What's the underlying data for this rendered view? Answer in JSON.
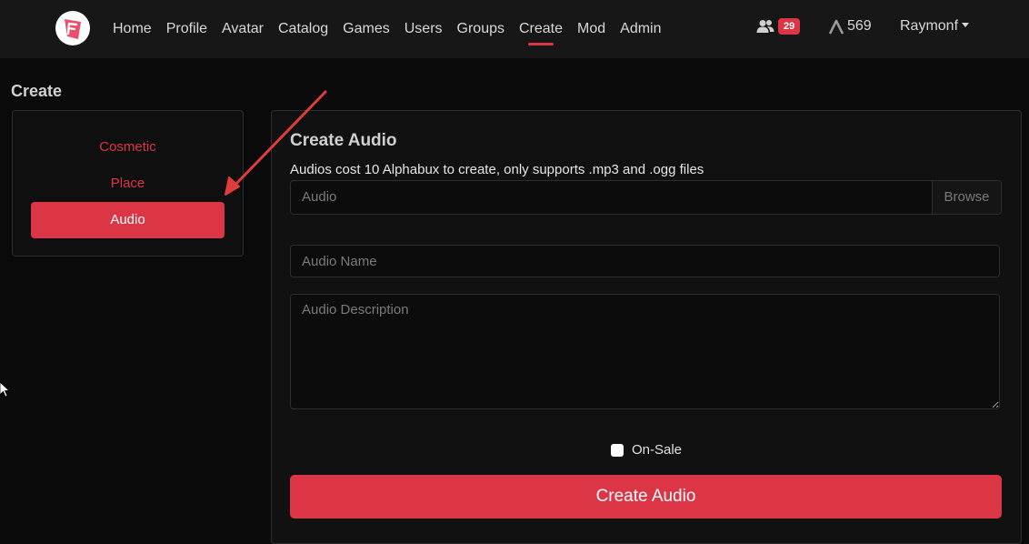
{
  "nav": {
    "items": [
      {
        "label": "Home"
      },
      {
        "label": "Profile"
      },
      {
        "label": "Avatar"
      },
      {
        "label": "Catalog"
      },
      {
        "label": "Games"
      },
      {
        "label": "Users"
      },
      {
        "label": "Groups"
      },
      {
        "label": "Create",
        "active": true
      },
      {
        "label": "Mod"
      },
      {
        "label": "Admin"
      }
    ],
    "friends_count": "29",
    "currency_amount": "569",
    "username": "Raymonf",
    "accent_color": "#dc3545"
  },
  "page": {
    "title": "Create"
  },
  "sidebar": {
    "items": [
      {
        "label": "Cosmetic"
      },
      {
        "label": "Place"
      },
      {
        "label": "Audio",
        "active": true
      }
    ]
  },
  "form": {
    "title": "Create Audio",
    "description": "Audios cost 10 Alphabux to create, only supports .mp3 and .ogg files",
    "file_placeholder": "Audio",
    "browse_label": "Browse",
    "name_placeholder": "Audio Name",
    "description_placeholder": "Audio Description",
    "on_sale_label": "On-Sale",
    "on_sale_checked": false,
    "submit_label": "Create Audio"
  },
  "icons": {
    "logo": "brand-logo-icon",
    "friends": "friends-icon",
    "currency": "alphabux-icon",
    "dropdown": "caret-down-icon"
  }
}
